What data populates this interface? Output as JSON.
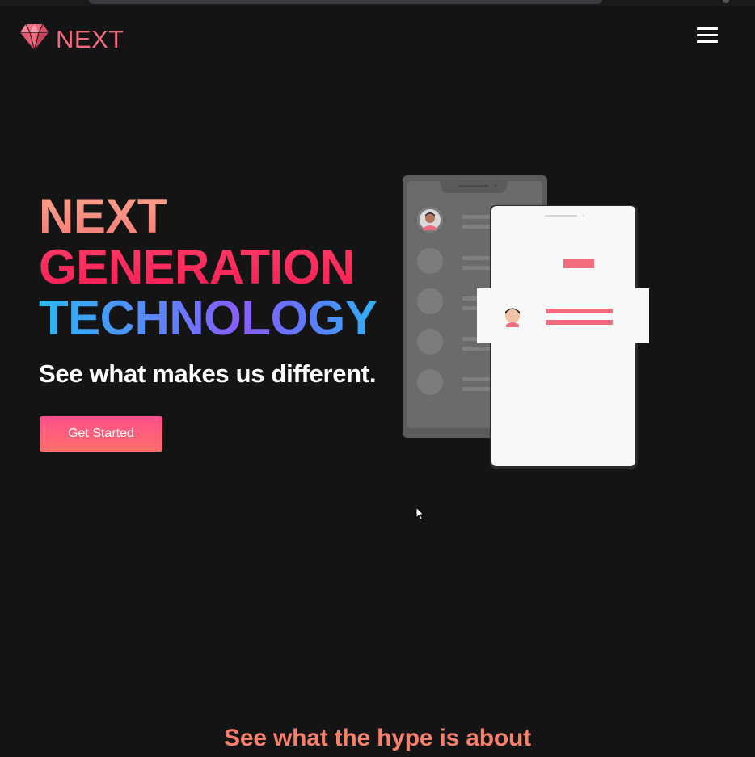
{
  "brand": {
    "name": "NEXT",
    "logo_icon": "diamond-icon",
    "accent": "#f36b7f"
  },
  "nav": {
    "menu_icon": "hamburger-menu-icon"
  },
  "hero": {
    "title_line1": "NEXT",
    "title_line2": "GENERATION",
    "title_line3": "TECHNOLOGY",
    "subtitle": "See what makes us different.",
    "cta_label": "Get Started",
    "illustration": "phone-chat-illustration"
  },
  "section": {
    "title": "See what the hype is about"
  },
  "colors": {
    "background": "#141414",
    "line1": "#f8907e",
    "line2": "#ff2d5f",
    "line3_gradient": [
      "#2ab8f0",
      "#8a5cff"
    ],
    "cta_gradient": [
      "#ff4f8c",
      "#ff6f6a"
    ],
    "section_title": "#f6806c"
  }
}
